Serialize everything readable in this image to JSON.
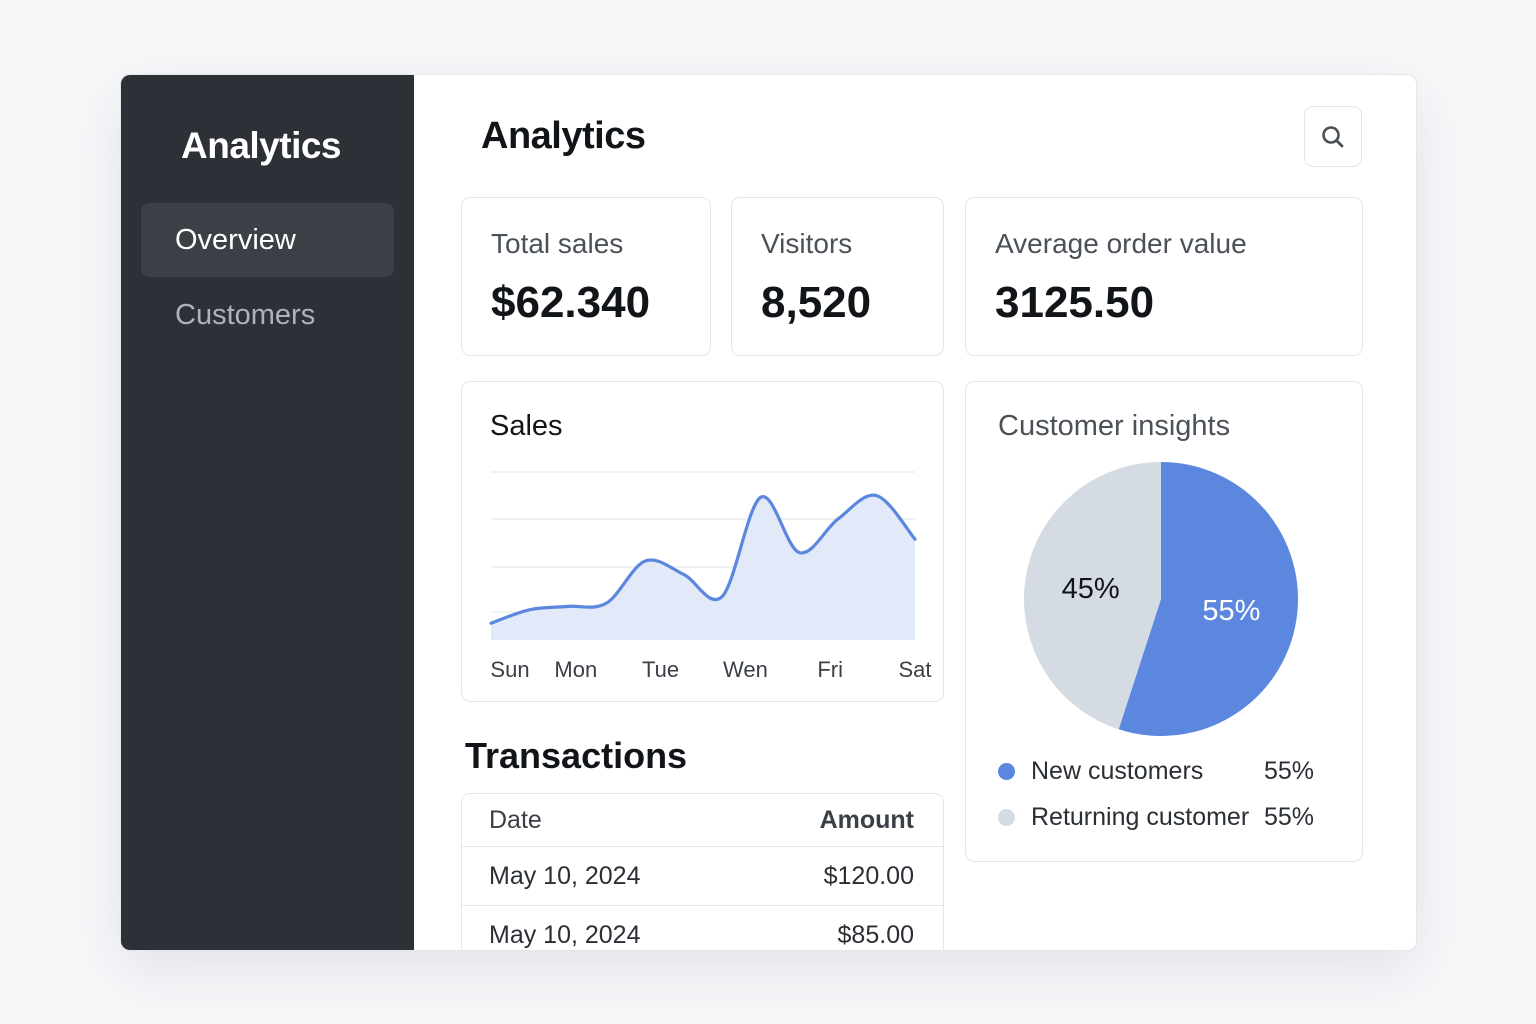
{
  "sidebar": {
    "brand": "Analytics",
    "items": [
      {
        "label": "Overview",
        "active": true
      },
      {
        "label": "Customers",
        "active": false
      }
    ]
  },
  "header": {
    "title": "Analytics",
    "search_icon": "search-icon"
  },
  "stats": [
    {
      "label": "Total sales",
      "value": "$62.340"
    },
    {
      "label": "Visitors",
      "value": "8,520"
    },
    {
      "label": "Average order value",
      "value": "3125.50"
    }
  ],
  "sales_card": {
    "title": "Sales"
  },
  "insights_card": {
    "title": "Customer insights",
    "legend": [
      {
        "label": "New customers",
        "pct": "55%",
        "color": "#5b87df"
      },
      {
        "label": "Returning customer",
        "pct": "55%",
        "color": "#d5dbe3"
      }
    ]
  },
  "transactions": {
    "title": "Transactions",
    "headers": {
      "date": "Date",
      "amount": "Amount"
    },
    "rows": [
      {
        "date": "May 10, 2024",
        "amount": "$120.00"
      },
      {
        "date": "May 10, 2024",
        "amount": "$85.00"
      }
    ]
  },
  "colors": {
    "accent": "#5b87df",
    "area_fill": "#e2eaf9",
    "sidebar": "#2d3137",
    "muted_slice": "#d5dbe3"
  },
  "chart_data": [
    {
      "type": "area",
      "title": "Sales",
      "categories": [
        "Sun",
        "Mon",
        "Tue",
        "Wen",
        "Fri",
        "Sat"
      ],
      "x": [
        0,
        0.5,
        1,
        1.5,
        2,
        2.5,
        3,
        3.5,
        4,
        4.5,
        5,
        5.5
      ],
      "values": [
        10,
        18,
        20,
        22,
        47,
        39,
        26,
        85,
        52,
        72,
        86,
        60
      ],
      "ylim": [
        0,
        100
      ],
      "grid": true,
      "xlabel": "",
      "ylabel": ""
    },
    {
      "type": "pie",
      "title": "Customer insights",
      "labels": [
        "New customers",
        "Returning customer"
      ],
      "values": [
        55,
        45
      ],
      "slice_labels": [
        "55%",
        "45%"
      ]
    }
  ]
}
